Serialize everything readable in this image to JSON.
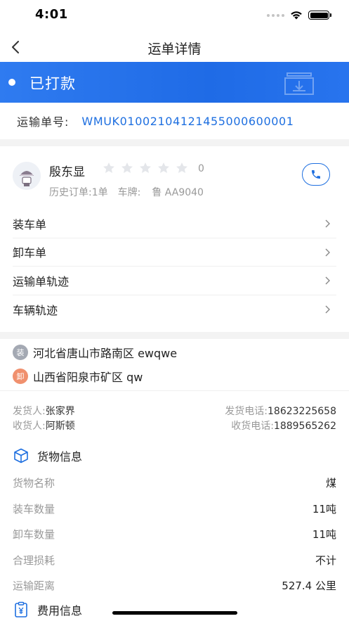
{
  "status_bar": {
    "time": "4:01"
  },
  "nav": {
    "title": "运单详情"
  },
  "banner": {
    "status": "已打款"
  },
  "waybill": {
    "label": "运输单号:",
    "number": "WMUK01002104121455000600001"
  },
  "driver": {
    "name": "殷东显",
    "rating": "0",
    "history_orders": "历史订单:1单",
    "plate_label": "车牌:",
    "plate": "鲁 AA9040",
    "stars_filled": 0,
    "stars_total": 5
  },
  "menu": [
    {
      "label": "装车单"
    },
    {
      "label": "卸车单"
    },
    {
      "label": "运输单轨迹"
    },
    {
      "label": "车辆轨迹"
    }
  ],
  "address": {
    "load_badge": "装",
    "load_address": "河北省唐山市路南区 ewqwe",
    "unload_badge": "卸",
    "unload_address": "山西省阳泉市矿区 qw"
  },
  "contacts": {
    "sender_label": "发货人:",
    "sender": "张家界",
    "sender_phone_label": "发货电话:",
    "sender_phone": "18623225658",
    "receiver_label": "收货人:",
    "receiver": "阿斯顿",
    "receiver_phone_label": "收货电话:",
    "receiver_phone": "1889565262"
  },
  "goods_section": {
    "title": "货物信息"
  },
  "goods": [
    {
      "label": "货物名称",
      "value": "煤"
    },
    {
      "label": "装车数量",
      "value": "11吨"
    },
    {
      "label": "卸车数量",
      "value": "11吨"
    },
    {
      "label": "合理损耗",
      "value": "不计"
    },
    {
      "label": "运输距离",
      "value": "527.4 公里"
    }
  ],
  "fee_section": {
    "title": "费用信息"
  },
  "colors": {
    "primary": "#1e6fe0",
    "unload_badge": "#f0906e",
    "load_badge": "#a4a9b3"
  }
}
